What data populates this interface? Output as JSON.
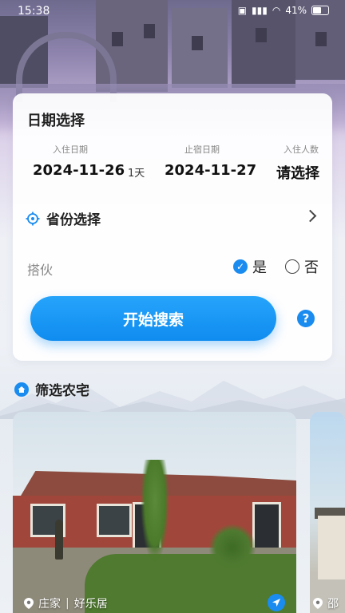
{
  "status_bar": {
    "time": "15:38",
    "battery": "41%"
  },
  "search_card": {
    "title": "日期选择",
    "checkin_label": "入住日期",
    "checkin_value": "2024-11-26",
    "nights": "1天",
    "checkout_label": "止宿日期",
    "checkout_value": "2024-11-27",
    "guests_label": "入住人数",
    "guests_value": "请选择",
    "province_label": "省份选择",
    "partner_label": "搭伙",
    "option_yes": "是",
    "option_no": "否",
    "search_button": "开始搜索",
    "help_icon": "?"
  },
  "filter_section": {
    "title": "筛选农宅"
  },
  "listings": [
    {
      "type": "庄家",
      "name": "好乐居"
    },
    {
      "type": "邵"
    }
  ],
  "colors": {
    "accent": "#1a8cf0"
  },
  "icons": [
    "location-target-icon",
    "chevron-right-icon",
    "check-icon",
    "help-icon",
    "home-icon",
    "location-pin-icon",
    "navigate-icon"
  ]
}
